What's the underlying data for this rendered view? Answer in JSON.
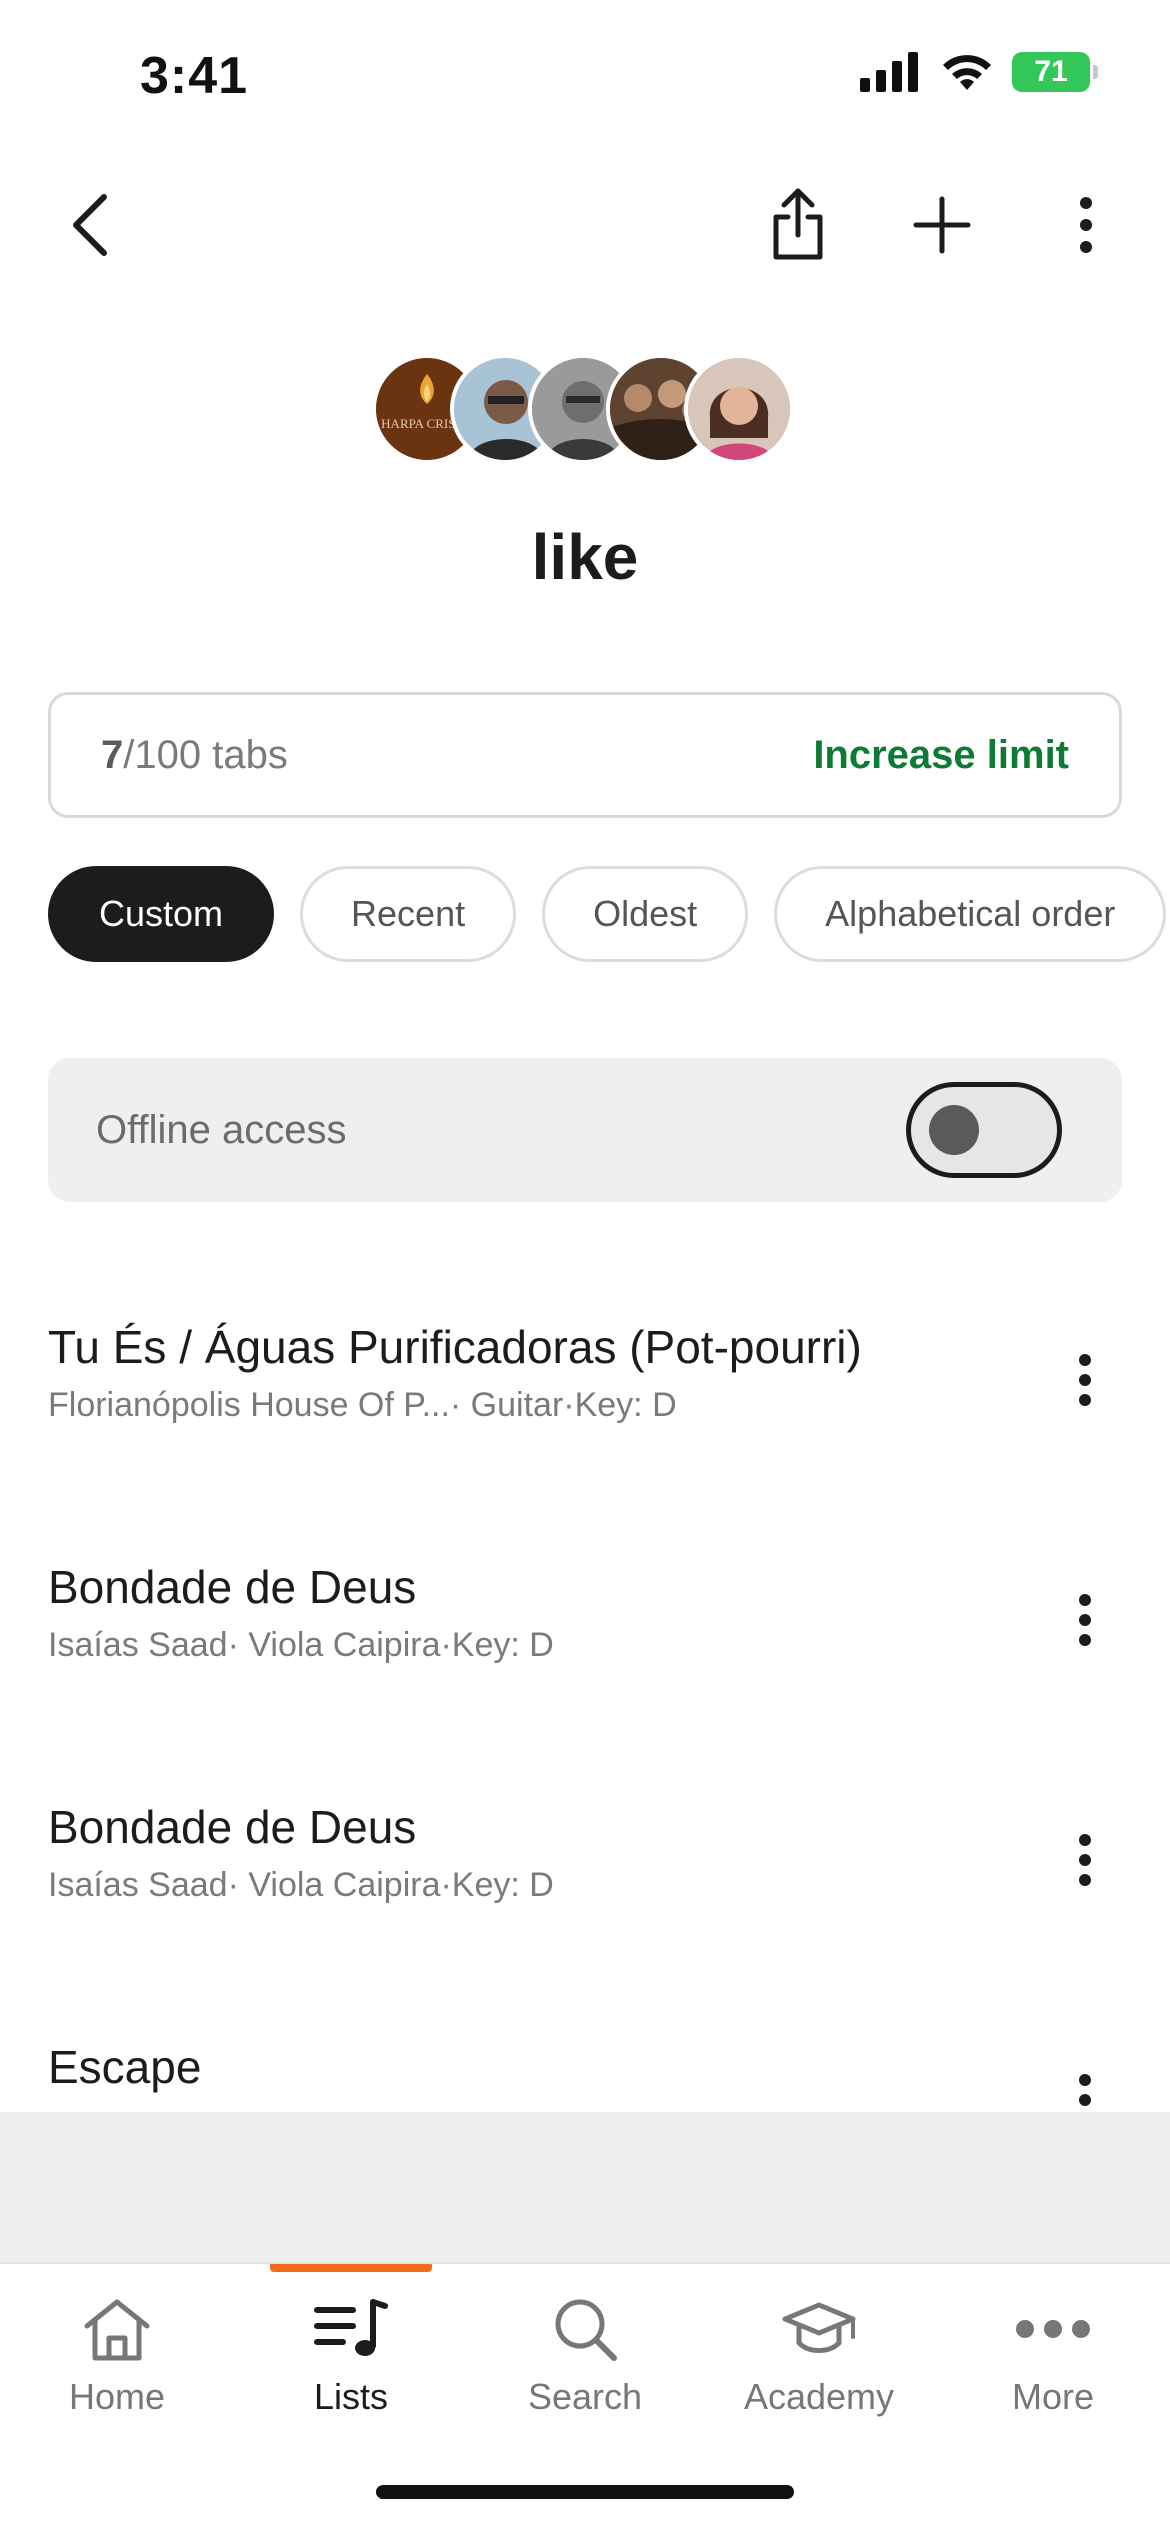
{
  "status_bar": {
    "time": "3:41",
    "battery": "71"
  },
  "list": {
    "title": "like",
    "avatars": [
      {
        "name": "avatar-harpa-crista",
        "text": "HARPA CRISTÃ",
        "color": "#7a3b12"
      },
      {
        "name": "avatar-artist-2",
        "text": "",
        "color": "#8fb0c8"
      },
      {
        "name": "avatar-artist-3",
        "text": "",
        "color": "#8b8b8b"
      },
      {
        "name": "avatar-artist-4",
        "text": "",
        "color": "#6a4a32"
      },
      {
        "name": "avatar-artist-5",
        "text": "",
        "color": "#c9a08a"
      }
    ]
  },
  "limit": {
    "count": "7",
    "total": "/100 tabs",
    "action": "Increase limit"
  },
  "sort_chips": [
    {
      "label": "Custom",
      "active": true
    },
    {
      "label": "Recent",
      "active": false
    },
    {
      "label": "Oldest",
      "active": false
    },
    {
      "label": "Alphabetical order",
      "active": false
    }
  ],
  "offline": {
    "label": "Offline access",
    "enabled": false
  },
  "songs": [
    {
      "title": "Tu És / Águas Purificadoras (Pot-pourri)",
      "meta": "Florianópolis House Of P...· Guitar·Key: D"
    },
    {
      "title": "Bondade de Deus",
      "meta": "Isaías Saad· Viola Caipira·Key: D"
    },
    {
      "title": "Bondade de Deus",
      "meta": "Isaías Saad· Viola Caipira·Key: D"
    },
    {
      "title": "Escape",
      "meta": ""
    }
  ],
  "tabs": [
    {
      "label": "Home",
      "icon": "home-icon",
      "active": false
    },
    {
      "label": "Lists",
      "icon": "lists-icon",
      "active": true
    },
    {
      "label": "Search",
      "icon": "search-icon",
      "active": false
    },
    {
      "label": "Academy",
      "icon": "academy-icon",
      "active": false
    },
    {
      "label": "More",
      "icon": "more-icon",
      "active": false
    }
  ],
  "colors": {
    "accent": "#0f7a34",
    "tab_indicator": "#f26b1d",
    "chip_active": "#1c1c1c"
  }
}
